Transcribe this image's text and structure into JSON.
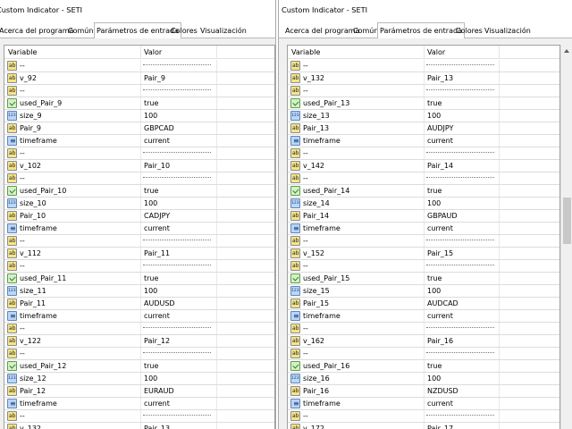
{
  "windows": [
    {
      "id": "left",
      "title": "Custom Indicator - SETI",
      "tabs": [
        "Acerca del programa",
        "Común",
        "Parámetros de entrada",
        "Colores",
        "Visualización"
      ],
      "active_tab": 2,
      "columns": {
        "variable": "Variable",
        "valor": "Valor"
      },
      "rows": [
        {
          "type": "ab",
          "name": "--",
          "value": "",
          "sep": true
        },
        {
          "type": "ab",
          "name": "v_92",
          "value": "Pair_9"
        },
        {
          "type": "ab",
          "name": "--",
          "value": "",
          "sep": true
        },
        {
          "type": "bool",
          "name": "used_Pair_9",
          "value": "true"
        },
        {
          "type": "num",
          "name": "size_9",
          "value": "100"
        },
        {
          "type": "ab",
          "name": "Pair_9",
          "value": "GBPCAD"
        },
        {
          "type": "tf",
          "name": "timeframe",
          "value": "current"
        },
        {
          "type": "ab",
          "name": "--",
          "value": "",
          "sep": true
        },
        {
          "type": "ab",
          "name": "v_102",
          "value": "Pair_10"
        },
        {
          "type": "ab",
          "name": "--",
          "value": "",
          "sep": true
        },
        {
          "type": "bool",
          "name": "used_Pair_10",
          "value": "true"
        },
        {
          "type": "num",
          "name": "size_10",
          "value": "100"
        },
        {
          "type": "ab",
          "name": "Pair_10",
          "value": "CADJPY"
        },
        {
          "type": "tf",
          "name": "timeframe",
          "value": "current"
        },
        {
          "type": "ab",
          "name": "--",
          "value": "",
          "sep": true
        },
        {
          "type": "ab",
          "name": "v_112",
          "value": "Pair_11"
        },
        {
          "type": "ab",
          "name": "--",
          "value": "",
          "sep": true
        },
        {
          "type": "bool",
          "name": "used_Pair_11",
          "value": "true"
        },
        {
          "type": "num",
          "name": "size_11",
          "value": "100"
        },
        {
          "type": "ab",
          "name": "Pair_11",
          "value": "AUDUSD"
        },
        {
          "type": "tf",
          "name": "timeframe",
          "value": "current"
        },
        {
          "type": "ab",
          "name": "--",
          "value": "",
          "sep": true
        },
        {
          "type": "ab",
          "name": "v_122",
          "value": "Pair_12"
        },
        {
          "type": "ab",
          "name": "--",
          "value": "",
          "sep": true
        },
        {
          "type": "bool",
          "name": "used_Pair_12",
          "value": "true"
        },
        {
          "type": "num",
          "name": "size_12",
          "value": "100"
        },
        {
          "type": "ab",
          "name": "Pair_12",
          "value": "EURAUD"
        },
        {
          "type": "tf",
          "name": "timeframe",
          "value": "current"
        },
        {
          "type": "ab",
          "name": "--",
          "value": "",
          "sep": true
        },
        {
          "type": "ab",
          "name": "v_132",
          "value": "Pair_13"
        }
      ]
    },
    {
      "id": "right",
      "title": "Custom Indicator - SETI",
      "tabs": [
        "Acerca del programa",
        "Común",
        "Parámetros de entrada",
        "Colores",
        "Visualización"
      ],
      "active_tab": 2,
      "columns": {
        "variable": "Variable",
        "valor": "Valor"
      },
      "rows": [
        {
          "type": "ab",
          "name": "--",
          "value": "",
          "sep": true
        },
        {
          "type": "ab",
          "name": "v_132",
          "value": "Pair_13"
        },
        {
          "type": "ab",
          "name": "--",
          "value": "",
          "sep": true
        },
        {
          "type": "bool",
          "name": "used_Pair_13",
          "value": "true"
        },
        {
          "type": "num",
          "name": "size_13",
          "value": "100"
        },
        {
          "type": "ab",
          "name": "Pair_13",
          "value": "AUDJPY"
        },
        {
          "type": "tf",
          "name": "timeframe",
          "value": "current"
        },
        {
          "type": "ab",
          "name": "--",
          "value": "",
          "sep": true
        },
        {
          "type": "ab",
          "name": "v_142",
          "value": "Pair_14"
        },
        {
          "type": "ab",
          "name": "--",
          "value": "",
          "sep": true
        },
        {
          "type": "bool",
          "name": "used_Pair_14",
          "value": "true"
        },
        {
          "type": "num",
          "name": "size_14",
          "value": "100"
        },
        {
          "type": "ab",
          "name": "Pair_14",
          "value": "GBPAUD"
        },
        {
          "type": "tf",
          "name": "timeframe",
          "value": "current"
        },
        {
          "type": "ab",
          "name": "--",
          "value": "",
          "sep": true
        },
        {
          "type": "ab",
          "name": "v_152",
          "value": "Pair_15"
        },
        {
          "type": "ab",
          "name": "--",
          "value": "",
          "sep": true
        },
        {
          "type": "bool",
          "name": "used_Pair_15",
          "value": "true"
        },
        {
          "type": "num",
          "name": "size_15",
          "value": "100"
        },
        {
          "type": "ab",
          "name": "Pair_15",
          "value": "AUDCAD"
        },
        {
          "type": "tf",
          "name": "timeframe",
          "value": "current"
        },
        {
          "type": "ab",
          "name": "--",
          "value": "",
          "sep": true
        },
        {
          "type": "ab",
          "name": "v_162",
          "value": "Pair_16"
        },
        {
          "type": "ab",
          "name": "--",
          "value": "",
          "sep": true
        },
        {
          "type": "bool",
          "name": "used_Pair_16",
          "value": "true"
        },
        {
          "type": "num",
          "name": "size_16",
          "value": "100"
        },
        {
          "type": "ab",
          "name": "Pair_16",
          "value": "NZDUSD"
        },
        {
          "type": "tf",
          "name": "timeframe",
          "value": "current"
        },
        {
          "type": "ab",
          "name": "--",
          "value": "",
          "sep": true
        },
        {
          "type": "ab",
          "name": "v_172",
          "value": "Pair_17"
        }
      ]
    }
  ]
}
